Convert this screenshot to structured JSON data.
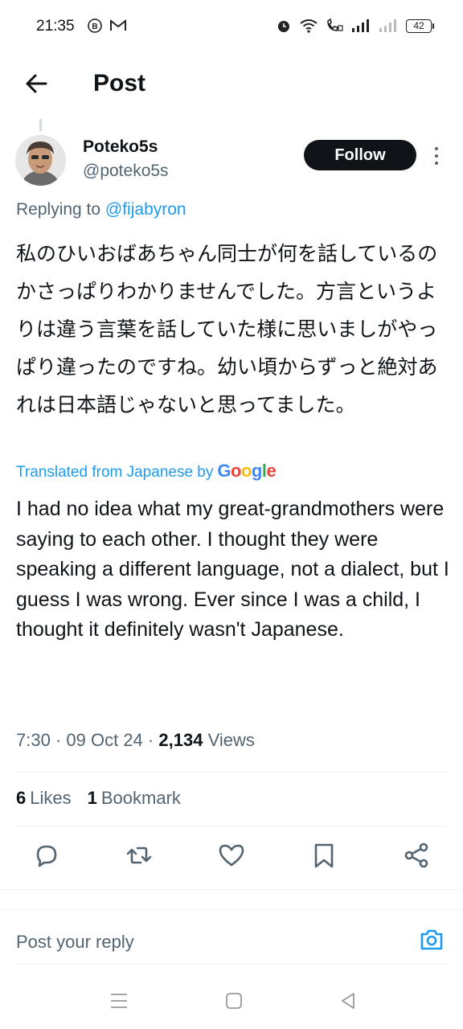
{
  "status_bar": {
    "time": "21:35",
    "battery": "42",
    "left_icons": [
      "b-circle-icon",
      "gmail-icon"
    ],
    "right_icons": [
      "alarm-icon",
      "wifi-icon",
      "call-icon",
      "signal-icon",
      "signal-weak-icon"
    ]
  },
  "header": {
    "title": "Post",
    "back_icon": "arrow-left-icon"
  },
  "author": {
    "display_name": "Poteko5s",
    "handle": "@poteko5s",
    "follow_label": "Follow"
  },
  "tweet": {
    "replying_prefix": "Replying to",
    "replying_to": "@fijabyron",
    "text": "私のひいおばあちゃん同士が何を話しているのかさっぱりわかりませんでした。方言というよりは違う言葉を話していた様に思いましがやっぱり違ったのですね。幼い頃からずっと絶対あれは日本語じゃないと思ってました。",
    "translated_label": "Translated from Japanese by",
    "translator": "Google",
    "translation": "I had no idea what my great-grandmothers were saying to each other. I thought they were speaking a different language, not a dialect, but I guess I was wrong. Ever since I was a child, I thought it definitely wasn't Japanese.",
    "time": "7:30",
    "date": "09 Oct 24",
    "views_count": "2,134",
    "views_label": "Views"
  },
  "stats": {
    "likes_count": "6",
    "likes_label": "Likes",
    "bookmarks_count": "1",
    "bookmarks_label": "Bookmark"
  },
  "actions": [
    "reply-icon",
    "repost-icon",
    "like-icon",
    "bookmark-icon",
    "share-icon"
  ],
  "reply_box": {
    "placeholder": "Post your reply"
  },
  "colors": {
    "accent": "#1d9bf0",
    "text": "#0f1419",
    "secondary": "#536471"
  }
}
